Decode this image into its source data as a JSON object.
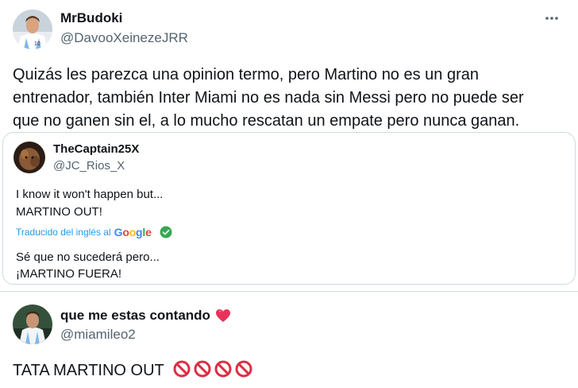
{
  "tweet": {
    "author_name": "MrBudoki",
    "author_handle": "@DavooXeinezeJRR",
    "text_line1": "Quizás les parezca una opinion termo, pero Martino no es un gran",
    "text_line2": "entrenador, también Inter Miami no es nada sin Messi pero no puede ser",
    "text_line3": "que no ganen sin el, a lo mucho rescatan un empate pero nunca ganan.",
    "more_icon": "more-horizontal-icon"
  },
  "quote": {
    "author_name": "TheCaptain25X",
    "author_handle": "@JC_Rios_X",
    "original_line1": "I know it won't happen but...",
    "original_line2": "MARTINO OUT!",
    "translated_label": "Traducido del inglés al",
    "translator_brand": "Google",
    "translated_line1": "Sé que no sucederá pero...",
    "translated_line2": "¡MARTINO FUERA!"
  },
  "reply": {
    "author_name": "que me estas contando",
    "author_handle": "@miamileo2",
    "text": "TATA MARTINO OUT",
    "name_emoji": "heart-icon",
    "trailing_emojis": [
      "prohibited-icon",
      "prohibited-icon",
      "prohibited-icon",
      "prohibited-icon"
    ]
  },
  "colors": {
    "text": "#0f1419",
    "secondary": "#536471",
    "link": "#1d9bf0",
    "border": "#cfd9de",
    "prohibited": "#dd2e44",
    "heart": "#e8325a"
  }
}
